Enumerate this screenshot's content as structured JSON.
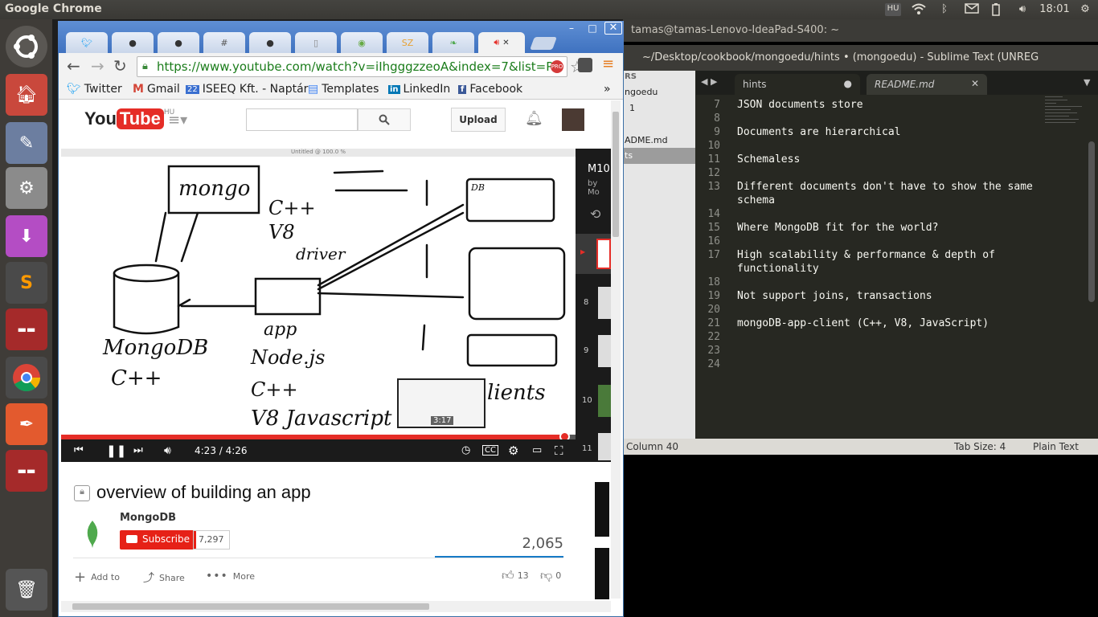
{
  "panel": {
    "app_name": "Google Chrome",
    "keyboard_layout": "HU",
    "time": "18:01"
  },
  "terminal": {
    "title": "tamas@tamas-Lenovo-IdeaPad-S400: ~"
  },
  "sublime": {
    "title": "~/Desktop/cookbook/mongoedu/hints • (mongoedu) - Sublime Text (UNREG",
    "sidebar_items": [
      "RS",
      "ngoedu",
      "1",
      "ADME.md",
      "ts"
    ],
    "tabs": [
      {
        "label": "hints",
        "dirty": true
      },
      {
        "label": "README.md",
        "dirty": false
      }
    ],
    "lines": [
      {
        "n": "7",
        "text": "JSON documents store"
      },
      {
        "n": "8",
        "text": ""
      },
      {
        "n": "9",
        "text": "Documents are hierarchical"
      },
      {
        "n": "10",
        "text": ""
      },
      {
        "n": "11",
        "text": "Schemaless"
      },
      {
        "n": "12",
        "text": ""
      },
      {
        "n": "13",
        "text": "Different documents don't have to show the same"
      },
      {
        "n": "",
        "text": "schema"
      },
      {
        "n": "14",
        "text": ""
      },
      {
        "n": "15",
        "text": "Where MongoDB fit for the world?"
      },
      {
        "n": "16",
        "text": ""
      },
      {
        "n": "17",
        "text": "High scalability & performance & depth of"
      },
      {
        "n": "",
        "text": "functionality"
      },
      {
        "n": "18",
        "text": ""
      },
      {
        "n": "19",
        "text": "Not support joins, transactions"
      },
      {
        "n": "20",
        "text": ""
      },
      {
        "n": "21",
        "text": "mongoDB-app-client (C++, V8, JavaScript)"
      },
      {
        "n": "22",
        "text": ""
      },
      {
        "n": "23",
        "text": ""
      },
      {
        "n": "24",
        "text": ""
      }
    ],
    "status": {
      "position": "Column 40",
      "tab_size": "Tab Size: 4",
      "syntax": "Plain Text"
    }
  },
  "chrome": {
    "tabs": [
      "",
      "",
      "",
      "",
      "",
      "",
      "",
      "",
      "",
      ""
    ],
    "url": "https://www.youtube.com/watch?v=iIhgggzzeoA&index=7&list=P",
    "bookmarks": [
      "Twitter",
      "Gmail",
      "ISEEQ Kft. - Naptár",
      "Templates",
      "LinkedIn",
      "Facebook"
    ],
    "bookmarks_more": "»",
    "calendar_badge": "22"
  },
  "youtube": {
    "logo_you": "You",
    "logo_tube": "Tube",
    "region": "HU",
    "search_placeholder": "",
    "upload": "Upload",
    "player": {
      "window_title": "Untitled @ 100.0 %",
      "time": "4:23 / 4:26",
      "preview_time": "3:17",
      "progress": 0.98
    },
    "drawing_labels": {
      "mongo": "mongo",
      "cpp_v8": "C++\nV8",
      "driver": "driver",
      "db": "DB",
      "app": "app",
      "nodejs": "Node.js",
      "cpp": "C++",
      "v8js": "V8 Javascript",
      "mongodb": "MongoDB",
      "mongodb_cpp": "C++",
      "clients": "lients"
    },
    "playlist": {
      "title": "M10",
      "by": "by Mo",
      "numbers": [
        "8",
        "9",
        "10",
        "11"
      ]
    },
    "video_title": "overview of building an app",
    "channel": "MongoDB",
    "subscribe": "Subscribe",
    "subscribers": "7,297",
    "views": "2,065",
    "add_to": "Add to",
    "share": "Share",
    "more": "More",
    "likes": "13",
    "dislikes": "0"
  }
}
